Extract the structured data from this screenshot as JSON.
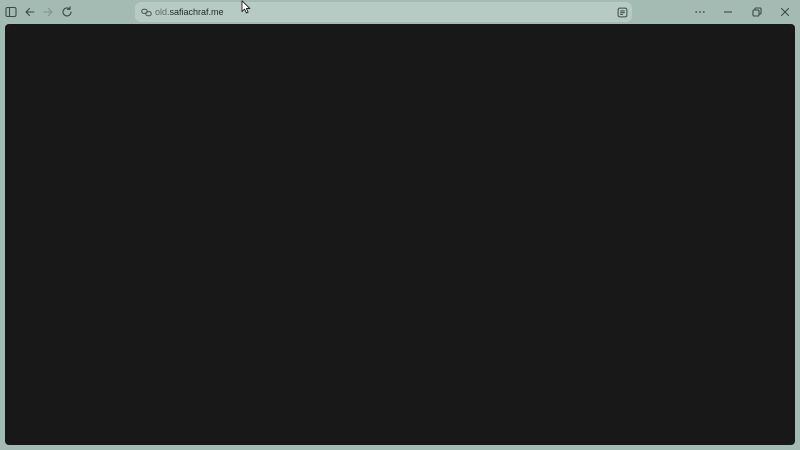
{
  "toolbar": {
    "icons": {
      "sidebar": "sidebar-toggle-icon",
      "back": "arrow-left-icon",
      "forward": "arrow-right-icon",
      "reload": "reload-icon",
      "more": "more-dots-icon",
      "minimize": "minimize-icon",
      "restore": "restore-icon",
      "close": "close-icon"
    }
  },
  "address_bar": {
    "url_subdomain": "old.",
    "url_domain": "safiachraf.me",
    "site_icon": "site-settings-icon",
    "reader_icon": "reader-mode-icon"
  },
  "colors": {
    "frame": "#a4bbb4",
    "address_bar": "#b7cac4",
    "page_background": "#181818"
  }
}
